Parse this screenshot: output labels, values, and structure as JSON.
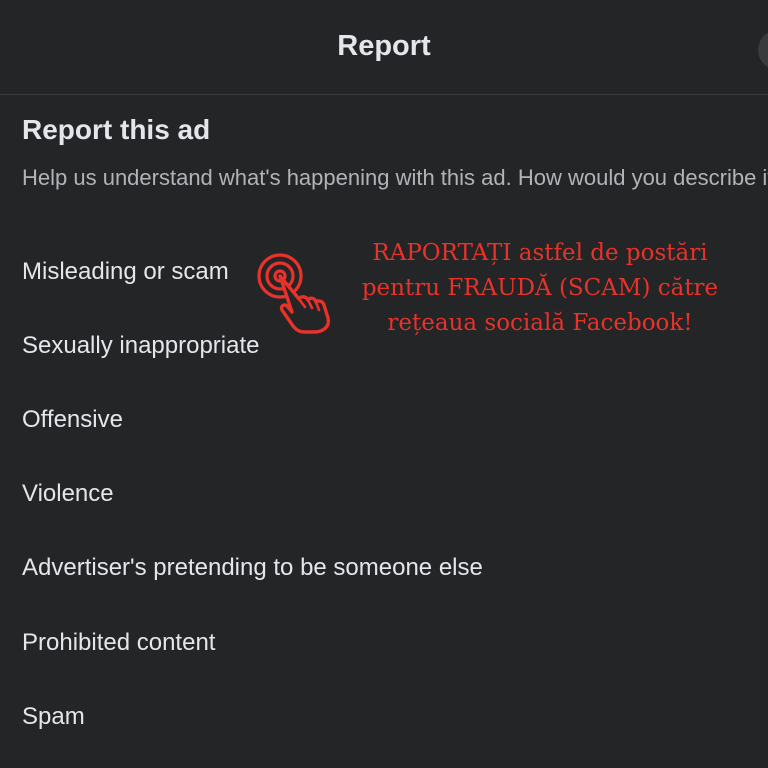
{
  "dialog": {
    "title": "Report",
    "heading": "Report this ad",
    "description": "Help us understand what's happening with this ad. How would you describe it?",
    "close_icon": "close-icon"
  },
  "options": [
    {
      "label": "Misleading or scam"
    },
    {
      "label": "Sexually inappropriate"
    },
    {
      "label": "Offensive"
    },
    {
      "label": "Violence"
    },
    {
      "label": "Advertiser's pretending to be someone else"
    },
    {
      "label": "Prohibited content"
    },
    {
      "label": "Spam"
    }
  ],
  "annotation": {
    "line1": "RAPORTAȚI astfel de postări",
    "line2": "pentru FRAUDĂ (SCAM) către",
    "line3": "rețeaua socială Facebook!",
    "color": "#e8322a",
    "icon": "tap-hand-icon"
  },
  "colors": {
    "background": "#242526",
    "text": "#e4e6eb",
    "secondary_text": "#b0b3b8",
    "divider": "#3a3b3c"
  }
}
